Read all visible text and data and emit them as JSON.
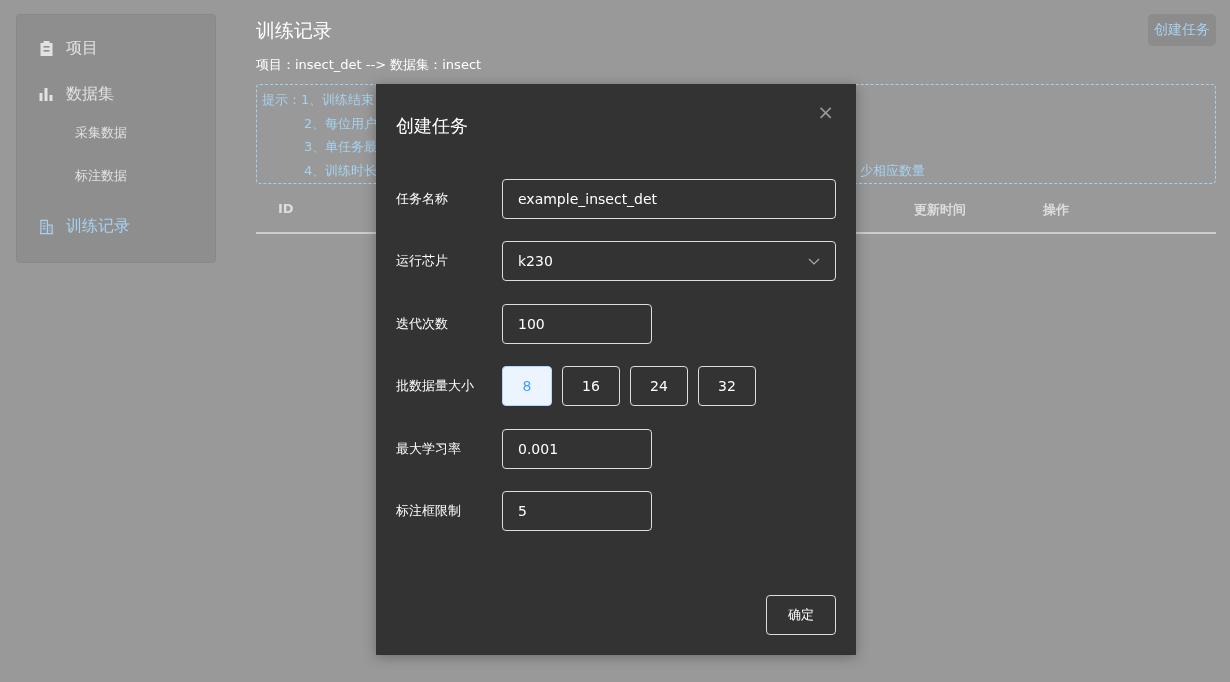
{
  "sidebar": {
    "items": [
      {
        "label": "项目",
        "selected": false
      },
      {
        "label": "数据集",
        "selected": false,
        "children": [
          {
            "label": "采集数据",
            "selected": false
          },
          {
            "label": "标注数据",
            "selected": false
          }
        ]
      },
      {
        "label": "训练记录",
        "selected": true
      }
    ]
  },
  "page": {
    "title": "训练记录",
    "breadcrumb": "项目：insect_det --> 数据集：insect",
    "create_button": "创建任务"
  },
  "hint": {
    "lines": [
      {
        "text": "提示：1、训练结束"
      },
      {
        "text": "2、每位用户"
      },
      {
        "text": "3、单任务最"
      },
      {
        "text": "4、训练时长",
        "tail": "少相应数量"
      }
    ]
  },
  "table": {
    "columns": [
      {
        "label": "ID"
      },
      {
        "label": "更新时间"
      },
      {
        "label": "操作"
      }
    ]
  },
  "dialog": {
    "title": "创建任务",
    "close": "×",
    "fields": [
      {
        "kind": "text",
        "label": "任务名称",
        "value": "example_insect_det",
        "wide": true
      },
      {
        "kind": "select",
        "label": "运行芯片",
        "value": "k230",
        "wide": true
      },
      {
        "kind": "text",
        "label": "迭代次数",
        "value": "100",
        "wide": false
      },
      {
        "kind": "choices",
        "label": "批数据量大小",
        "options": [
          {
            "label": "8",
            "selected": true
          },
          {
            "label": "16",
            "selected": false
          },
          {
            "label": "24",
            "selected": false
          },
          {
            "label": "32",
            "selected": false
          }
        ]
      },
      {
        "kind": "text",
        "label": "最大学习率",
        "value": "0.001",
        "wide": false
      },
      {
        "kind": "text",
        "label": "标注框限制",
        "value": "5",
        "wide": false
      }
    ],
    "confirm": "确定"
  }
}
